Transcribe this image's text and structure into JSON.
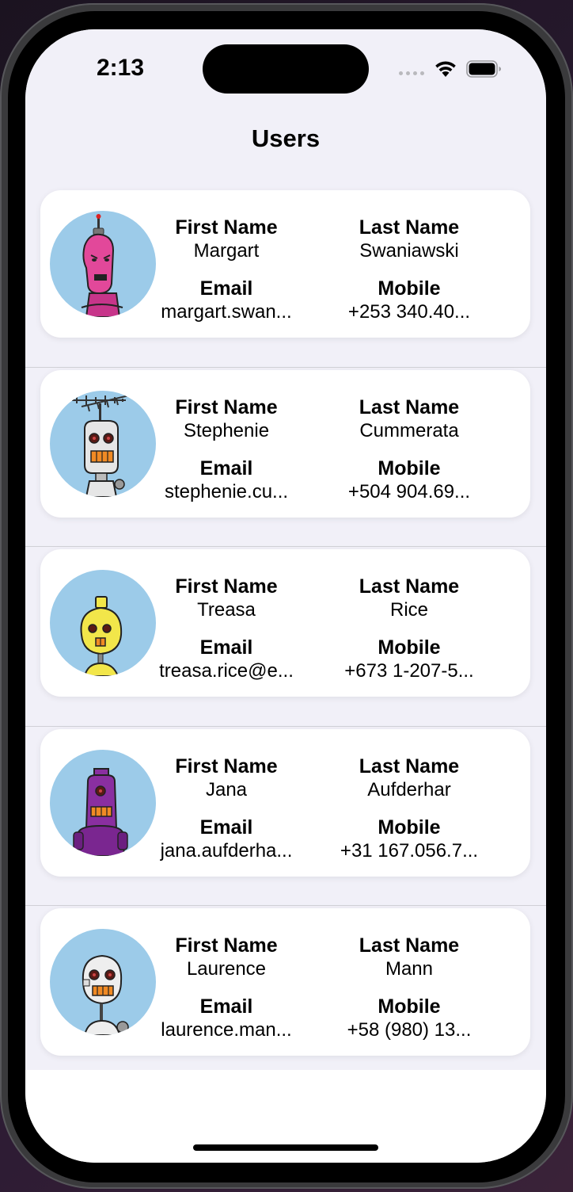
{
  "status_bar": {
    "time": "2:13",
    "wifi_icon": "wifi-icon",
    "battery_icon": "battery-icon"
  },
  "nav": {
    "title": "Users"
  },
  "labels": {
    "first_name": "First Name",
    "last_name": "Last Name",
    "email": "Email",
    "mobile": "Mobile"
  },
  "users": [
    {
      "first_name": "Margart",
      "last_name": "Swaniawski",
      "email": "margart.swan...",
      "mobile": "+253 340.40...",
      "avatar_color": "#e2489a",
      "avatar_icon": "pink-robot-avatar"
    },
    {
      "first_name": "Stephenie",
      "last_name": "Cummerata",
      "email": "stephenie.cu...",
      "mobile": "+504 904.69...",
      "avatar_color": "#e6e6e6",
      "avatar_icon": "antenna-robot-avatar"
    },
    {
      "first_name": "Treasa",
      "last_name": "Rice",
      "email": "treasa.rice@e...",
      "mobile": "+673 1-207-5...",
      "avatar_color": "#f2e64a",
      "avatar_icon": "yellow-robot-avatar"
    },
    {
      "first_name": "Jana",
      "last_name": "Aufderhar",
      "email": "jana.aufderha...",
      "mobile": "+31 167.056.7...",
      "avatar_color": "#8a2fa0",
      "avatar_icon": "purple-robot-avatar"
    },
    {
      "first_name": "Laurence",
      "last_name": "Mann",
      "email": "laurence.man...",
      "mobile": "+58 (980) 13...",
      "avatar_color": "#eeeeee",
      "avatar_icon": "white-robot-avatar"
    }
  ],
  "colors": {
    "background": "#f1f0f8",
    "card": "#ffffff",
    "avatar_bg": "#9ccbe9"
  }
}
